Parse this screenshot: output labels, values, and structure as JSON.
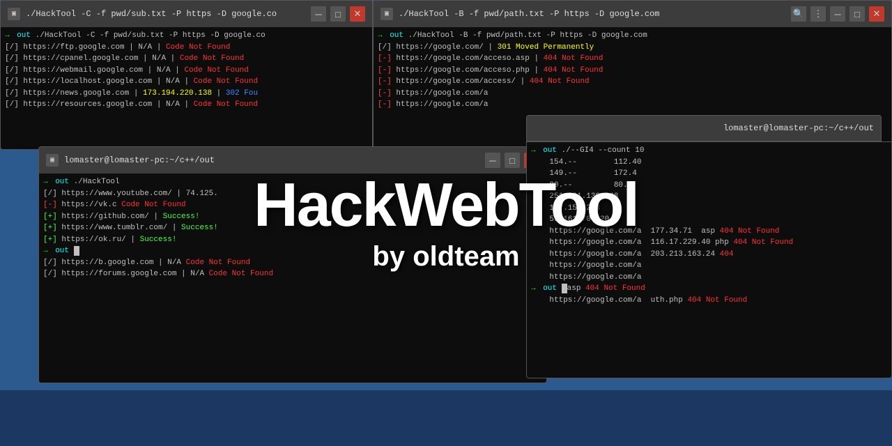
{
  "windows": {
    "win1": {
      "title": "./HackTool -C -f pwd/sub.txt -P https -D google.co",
      "username": "lomaster@lomaster-pc",
      "path": "~/c++/out",
      "lines": [
        {
          "type": "cmd",
          "text": "out ./HackTool -C -f pwd/sub.txt -P https -D google.co"
        },
        {
          "type": "ok",
          "url": "https://ftp.google.com",
          "status": "N/A",
          "code": "Code Not Found"
        },
        {
          "type": "ok",
          "url": "https://cpanel.google.com",
          "status": "N/A",
          "code": "Code Not Found"
        },
        {
          "type": "ok",
          "url": "https://webmail.google.com",
          "status": "N/A",
          "code": "Code Not Found"
        },
        {
          "type": "ok",
          "url": "https://localhost.google.com",
          "status": "N/A",
          "code": "Code Not Found"
        },
        {
          "type": "ok",
          "url": "https://news.google.com",
          "status": "173.194.220.138",
          "code": "302 Fou"
        },
        {
          "type": "ok",
          "url": "https://resources.google.com",
          "status": "N/A",
          "code": "Code Not Found"
        }
      ]
    },
    "win2": {
      "title": "./HackTool -B -f pwd/path.txt -P https -D google.com",
      "username": "lomaster@lomaster-pc",
      "path": "~/c++/out",
      "lines": [
        {
          "type": "cmd",
          "text": "out ./HackTool -B -f pwd/path.txt -P https -D google.com"
        },
        {
          "type": "ok301",
          "url": "https://google.com/",
          "status": "301 Moved Permanently"
        },
        {
          "type": "err404",
          "url": "https://google.com/acceso.asp",
          "status": "404 Not Found"
        },
        {
          "type": "err404",
          "url": "https://google.com/acceso.php",
          "status": "404 Not Found"
        },
        {
          "type": "err404",
          "url": "https://google.com/access/",
          "status": "404 Not Found"
        },
        {
          "type": "partial",
          "url": "https://google.com/a",
          "status": ""
        },
        {
          "type": "partial",
          "url": "https://google.com/a",
          "status": ""
        }
      ]
    },
    "win3": {
      "title": "lomaster@lomaster-pc:~/c++/out",
      "lines": [
        {
          "type": "cmd",
          "text": "out ./HackTool"
        },
        {
          "type": "ok",
          "url": "https://www.youtube.com/",
          "ip": "74.125.39.46",
          "extra": ""
        },
        {
          "type": "partial",
          "url": "https://vk.c"
        },
        {
          "type": "ok_s",
          "url": "https://github.com/",
          "status": "Success!"
        },
        {
          "type": "ok_s",
          "url": "https://www.tumblr.com/",
          "status": "Success!"
        },
        {
          "type": "ok_s",
          "url": "https://ok.ru/",
          "status": "Success!"
        },
        {
          "type": "nf",
          "url": "https://b.google.com",
          "status": "N/A",
          "code": "Code Not Found"
        },
        {
          "type": "nf",
          "url": "https://forums.google.com",
          "status": "N/A",
          "code": "Code Not Found"
        }
      ]
    },
    "win4": {
      "title": "lomaster@lomaster-pc:~/c++/out",
      "lines": [
        {
          "type": "cmd2",
          "text": "out ./--GI4 --count 10"
        },
        {
          "ip": "154.--",
          "extra": "112.40"
        },
        {
          "ip": "149.--",
          "extra": "172.4"
        },
        {
          "ip": "80.--",
          "extra": "80.1"
        },
        {
          "ip": "251.231.130.248",
          "extra": ""
        },
        {
          "ip": "147.154.223",
          "extra": ""
        },
        {
          "ip": "55.161.70.220",
          "extra": ""
        },
        {
          "url": "https://google.com/a",
          "ip": "177.34.71",
          "ext": "asp",
          "status": "404 Not Found"
        },
        {
          "url": "https://google.com/a",
          "ip": "116.17.229.40",
          "ext": "php",
          "status": "404 Not Found"
        },
        {
          "url": "https://google.com/a",
          "ip": "203.213.163.24",
          "status": "404"
        },
        {
          "url": "https://google.com/a",
          "ip": "",
          "status": ""
        },
        {
          "url": "https://google.com/a",
          "ip": "",
          "status": ""
        },
        {
          "type": "cmd_end",
          "text": "out",
          "ext": "asp",
          "status": "404 Not Found"
        },
        {
          "url": "https://google.com/a",
          "ext": "uth.php",
          "status": "404 Not Found"
        }
      ]
    }
  },
  "overlay": {
    "title": "HackWebTool",
    "subtitle": "by oldteam"
  },
  "icons": {
    "terminal": "▣",
    "minimize": "─",
    "maximize": "□",
    "close": "✕",
    "search": "🔍",
    "menu": "⋮"
  }
}
